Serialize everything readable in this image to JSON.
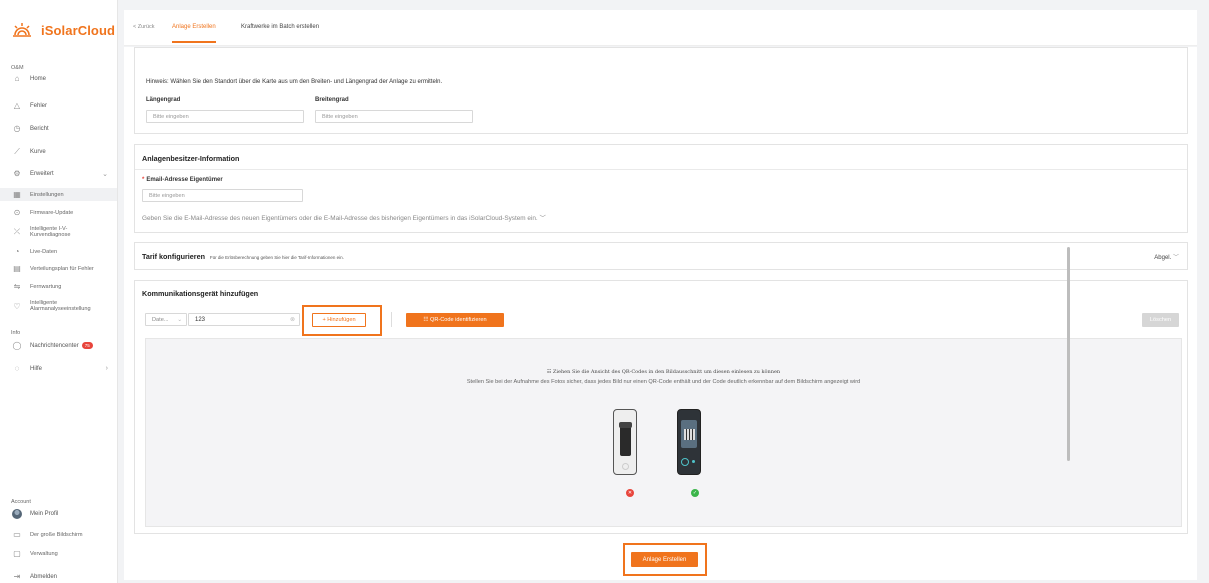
{
  "app": {
    "title": "iSolarCloud",
    "accent": "#f0741d"
  },
  "sidebar": {
    "sections": {
      "om": "O&M",
      "info": "Info",
      "account": "Account"
    },
    "items": {
      "home": "Home",
      "fehler": "Fehler",
      "bericht": "Bericht",
      "kurve": "Kurve",
      "erweitert": "Erweitert",
      "einstellungen": "Einstellungen",
      "firmware": "Firmware-Update",
      "iv_line1": "Intelligente I-V-",
      "iv_line2": "Kurvendiagnose",
      "live": "Live-Daten",
      "verteilung": "Verteilungsplan für Fehler",
      "fernwartung": "Fernwartung",
      "alarm_line1": "Intelligente",
      "alarm_line2": "Alarmanalyseeinstellung",
      "nachrichten": "Nachrichtencenter",
      "nachrichten_badge": "75",
      "hilfe": "Hilfe",
      "profil": "Mein Profil",
      "bildschirm": "Der große Bildschirm",
      "verwaltung": "Verwaltung",
      "abmelden": "Abmelden"
    }
  },
  "tabs": {
    "back": "< Zurück",
    "create": "Anlage Erstellen",
    "batch": "Kraftwerke im Batch erstellen"
  },
  "location": {
    "hint": "Hinweis: Wählen Sie den Standort über die Karte aus um den Breiten- und Längengrad der Anlage zu ermitteln.",
    "longitude_label": "Längengrad",
    "latitude_label": "Breitengrad",
    "placeholder": "Bitte eingeben"
  },
  "owner": {
    "title": "Anlagenbesitzer-Information",
    "email_label": "Email-Adresse Eigentümer",
    "placeholder": "Bitte eingeben",
    "note": "Geben Sie die E-Mail-Adresse des neuen Eigentümers oder die E-Mail-Adresse des bisherigen Eigentümers in das iSolarCloud-System ein."
  },
  "tariff": {
    "title": "Tarif konfigurieren",
    "subtitle": "Für die Erlösberechnung geben Sie hier die Tarif-Informationen ein.",
    "collapse": "Abgel."
  },
  "device": {
    "title": "Kommunikationsgerät hinzufügen",
    "select_value": "Date...",
    "input_value": "123",
    "add_button": "+ Hinzufügen",
    "qr_button": "QR-Code identifizieren",
    "delete_button": "Löschen",
    "drop_title": "Ziehen Sie die Ansicht des QR-Codes in den Bildausschnitt um diesen einlesen zu können",
    "drop_sub": "Stellen Sie bei der Aufnahme des Fotos sicher, dass jedes Bild nur einen QR-Code enthält und der Code deutlich erkennbar auf dem Bildschirm angezeigt wird"
  },
  "submit": "Anlage Erstellen"
}
